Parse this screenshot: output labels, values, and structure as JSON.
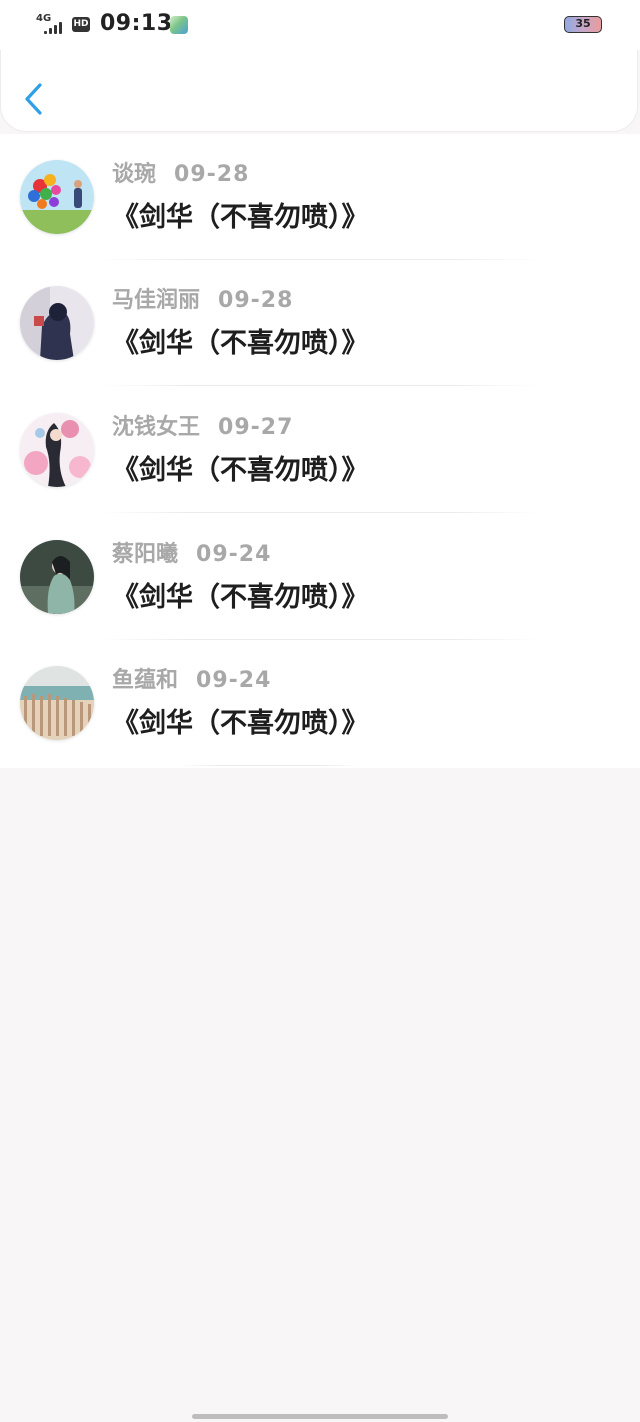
{
  "status_bar": {
    "network": "4G",
    "hd": "HD",
    "time": "09:13",
    "battery": "35"
  },
  "header": {
    "back_icon": "chevron-left-icon",
    "accent_color": "#2f9fe6"
  },
  "items": [
    {
      "name": "谈琬",
      "date": "09-28",
      "title": "《剑华（不喜勿喷）》"
    },
    {
      "name": "马佳润丽",
      "date": "09-28",
      "title": "《剑华（不喜勿喷）》"
    },
    {
      "name": "沈钱女王",
      "date": "09-27",
      "title": "《剑华（不喜勿喷）》"
    },
    {
      "name": "蔡阳曦",
      "date": "09-24",
      "title": "《剑华（不喜勿喷）》"
    },
    {
      "name": "鱼蕴和",
      "date": "09-24",
      "title": "《剑华（不喜勿喷）》"
    }
  ]
}
